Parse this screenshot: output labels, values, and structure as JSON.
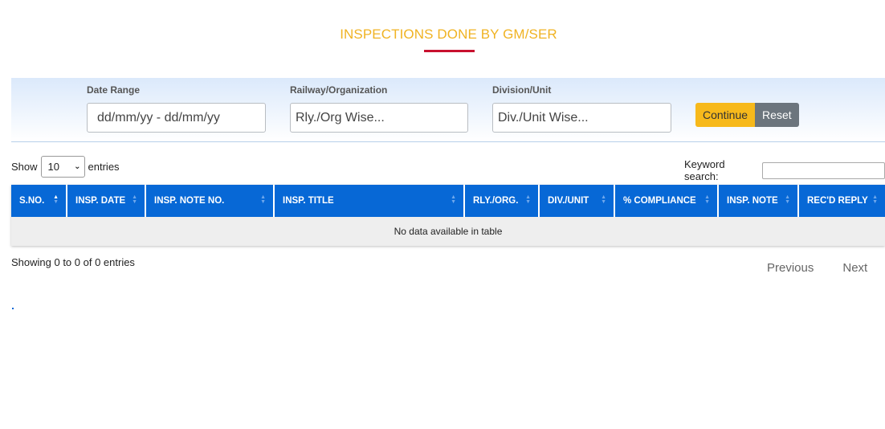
{
  "page": {
    "title": "INSPECTIONS DONE BY GM/SER"
  },
  "filters": {
    "date_range": {
      "label": "Date Range",
      "placeholder": "dd/mm/yy - dd/mm/yy"
    },
    "railway": {
      "label": "Railway/Organization",
      "placeholder": "Rly./Org Wise..."
    },
    "division": {
      "label": "Division/Unit",
      "placeholder": "Div./Unit Wise..."
    },
    "continue_label": "Continue",
    "reset_label": "Reset"
  },
  "length_menu": {
    "show_label": "Show",
    "selected": "10",
    "entries_label": "entries"
  },
  "search": {
    "label": "Keyword search:",
    "value": ""
  },
  "table": {
    "columns": [
      "S.NO.",
      "INSP. DATE",
      "INSP. NOTE NO.",
      "INSP. TITLE",
      "RLY./ORG.",
      "DIV./UNIT",
      "% COMPLIANCE",
      "INSP. NOTE",
      "REC'D REPLY"
    ],
    "empty_message": "No data available in table"
  },
  "footer": {
    "info": "Showing 0 to 0 of 0 entries",
    "previous_label": "Previous",
    "next_label": "Next"
  },
  "colors": {
    "title": "#f0b323",
    "underline": "#c8102e",
    "header_bg": "#0768d6",
    "continue_bg": "#f7b91b",
    "reset_bg": "#6c757d"
  }
}
